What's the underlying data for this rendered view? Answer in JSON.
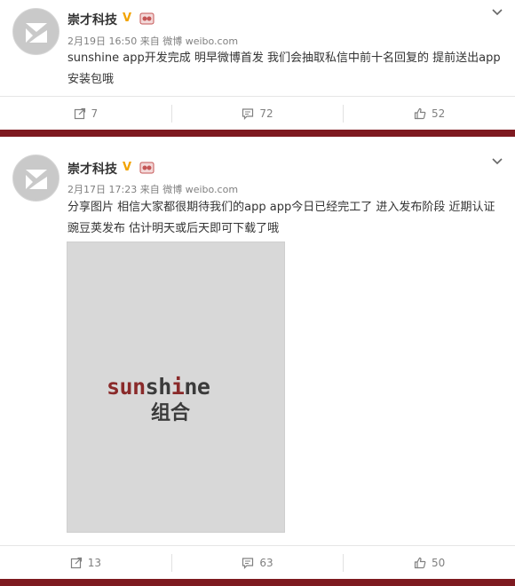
{
  "posts": [
    {
      "author": "崇才科技",
      "verified_badge": "V",
      "time": "2月19日 16:50",
      "source_prefix": "来自",
      "source": "微博 weibo.com",
      "text": "sunshine app开发完成 明早微博首发 我们会抽取私信中前十名回复的 提前送出app安装包哦",
      "repost_count": "7",
      "comment_count": "72",
      "like_count": "52"
    },
    {
      "author": "崇才科技",
      "verified_badge": "V",
      "time": "2月17日 17:23",
      "source_prefix": "来自",
      "source": "微博 weibo.com",
      "text": "分享图片 相信大家都很期待我们的app app今日已经完工了 进入发布阶段 近期认证豌豆荚发布 估计明天或后天即可下载了哦",
      "image": {
        "logo_prefix": "sun",
        "logo_mid": "sh",
        "logo_accent": "i",
        "logo_suffix": "ne",
        "logo_cn": "组合"
      },
      "repost_count": "13",
      "comment_count": "63",
      "like_count": "50"
    }
  ],
  "colors": {
    "divider": "#7e1a20",
    "logo_red": "#8a2a2a",
    "logo_grey": "#3b3b3b",
    "badge": "#f2a300"
  },
  "icons": [
    "avatar-logo",
    "verified-badge",
    "member-badge",
    "chevron-down-icon",
    "repost-icon",
    "comment-icon",
    "like-icon"
  ]
}
